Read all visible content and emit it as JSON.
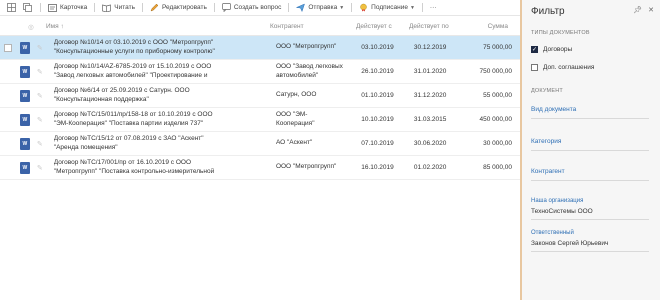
{
  "toolbar": {
    "card": "Карточка",
    "read": "Читать",
    "edit": "Редактировать",
    "ask_question": "Создать вопрос",
    "send": "Отправка",
    "sign": "Подписание"
  },
  "table": {
    "headers": {
      "name": "Имя",
      "name_sort": "↑",
      "counterparty": "Контрагент",
      "valid_from": "Действует с",
      "valid_to": "Действует по",
      "amount": "Сумма"
    },
    "rows": [
      {
        "name1": "Договор №10/14 от 03.10.2019 с ООО \"Метропгрупп\"",
        "name2": "\"Консультационные услуги по приборному контролю\"",
        "agent1": "ООО \"Метропгрупп\"",
        "agent2": "",
        "from": "03.10.2019",
        "to": "30.12.2019",
        "sum": "75 000,00"
      },
      {
        "name1": "Договор №10/14/АZ-6785-2019 от 15.10.2019 с ООО",
        "name2": "\"Завод легковых автомобилей\" \"Проектирование и",
        "agent1": "ООО \"Завод легковых",
        "agent2": "автомобилей\"",
        "from": "26.10.2019",
        "to": "31.01.2020",
        "sum": "750 000,00"
      },
      {
        "name1": "Договор №6/14 от 25.09.2019 с Сатурн. ООО",
        "name2": "\"Консультационная поддержка\"",
        "agent1": "Сатурн, ООО",
        "agent2": "",
        "from": "01.10.2019",
        "to": "31.12.2020",
        "sum": "55 000,00"
      },
      {
        "name1": "Договор №ТС/15/011/пр/158-18 от 10.10.2019 с ООО",
        "name2": "\"ЭМ-Кооперация\" \"Поставка партии изделия 737\"",
        "agent1": "ООО \"ЭМ-",
        "agent2": "Кооперация\"",
        "from": "10.10.2019",
        "to": "31.03.2015",
        "sum": "450 000,00"
      },
      {
        "name1": "Договор №ТС/15/12 от 07.08.2019 с ЗАО \"Аскент\"",
        "name2": "\"Аренда помещения\"",
        "agent1": "АО \"Аскент\"",
        "agent2": "",
        "from": "07.10.2019",
        "to": "30.06.2020",
        "sum": "30 000,00"
      },
      {
        "name1": "Договор №ТС/17/001/пр от 16.10.2019 с ООО",
        "name2": "\"Метропгрупп\" \"Поставка контрольно-измерительной",
        "agent1": "ООО \"Метропгрупп\"",
        "agent2": "",
        "from": "16.10.2019",
        "to": "01.02.2020",
        "sum": "85 000,00"
      }
    ]
  },
  "filter": {
    "title": "Фильтр",
    "doc_types_label": "ТИПЫ ДОКУМЕНТОВ",
    "opt_contracts": "Договоры",
    "opt_agreements": "Доп. соглашения",
    "document_label": "ДОКУМЕНТ",
    "doc_kind": "Вид документа",
    "category": "Категория",
    "counterparty": "Контрагент",
    "our_org_label": "Наша организация",
    "our_org_value": "ТехноСистемы ООО",
    "responsible_label": "Ответственный",
    "responsible_value": "Законов Сергей Юрьевич"
  }
}
